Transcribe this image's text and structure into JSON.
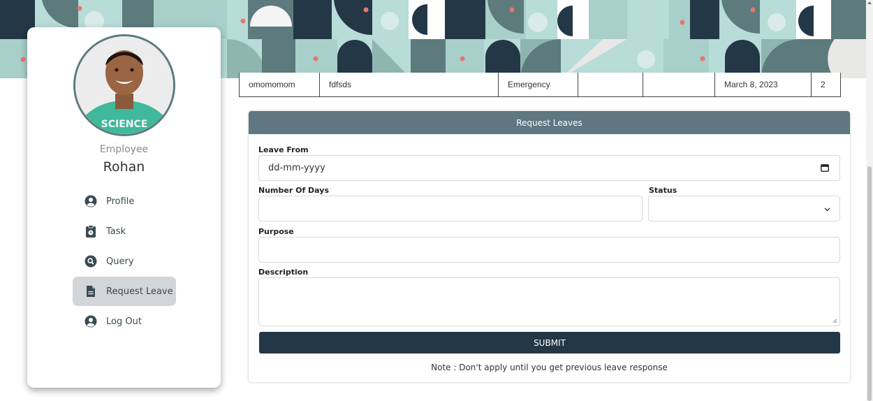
{
  "sidebar": {
    "role": "Employee",
    "name": "Rohan",
    "avatar_shirt_text": "SCIENCE",
    "nav": [
      {
        "label": "Profile",
        "icon": "user-circle-icon",
        "active": false
      },
      {
        "label": "Task",
        "icon": "clipboard-icon",
        "active": false
      },
      {
        "label": "Query",
        "icon": "search-circle-icon",
        "active": false
      },
      {
        "label": "Request Leave",
        "icon": "file-icon",
        "active": true
      },
      {
        "label": "Log Out",
        "icon": "user-circle-icon",
        "active": false
      }
    ]
  },
  "leave_table": {
    "row": [
      "omomomom",
      "fdfsds",
      "Emergency",
      "",
      "",
      "March 8, 2023",
      "2"
    ]
  },
  "form": {
    "title": "Request Leaves",
    "leave_from_label": "Leave From",
    "leave_from_placeholder": "dd-mm-yyyy",
    "days_label": "Number Of Days",
    "status_label": "Status",
    "purpose_label": "Purpose",
    "description_label": "Description",
    "submit_label": "SUBMIT",
    "note": "Note : Don't apply until you get previous leave response"
  },
  "colors": {
    "header": "#5e7780",
    "submit": "#243746",
    "active_nav": "#d3d6d9",
    "banner_teal": "#5d7a7d",
    "banner_navy": "#243746",
    "banner_mint": "#b8dcd8",
    "banner_coral": "#e8766b"
  }
}
